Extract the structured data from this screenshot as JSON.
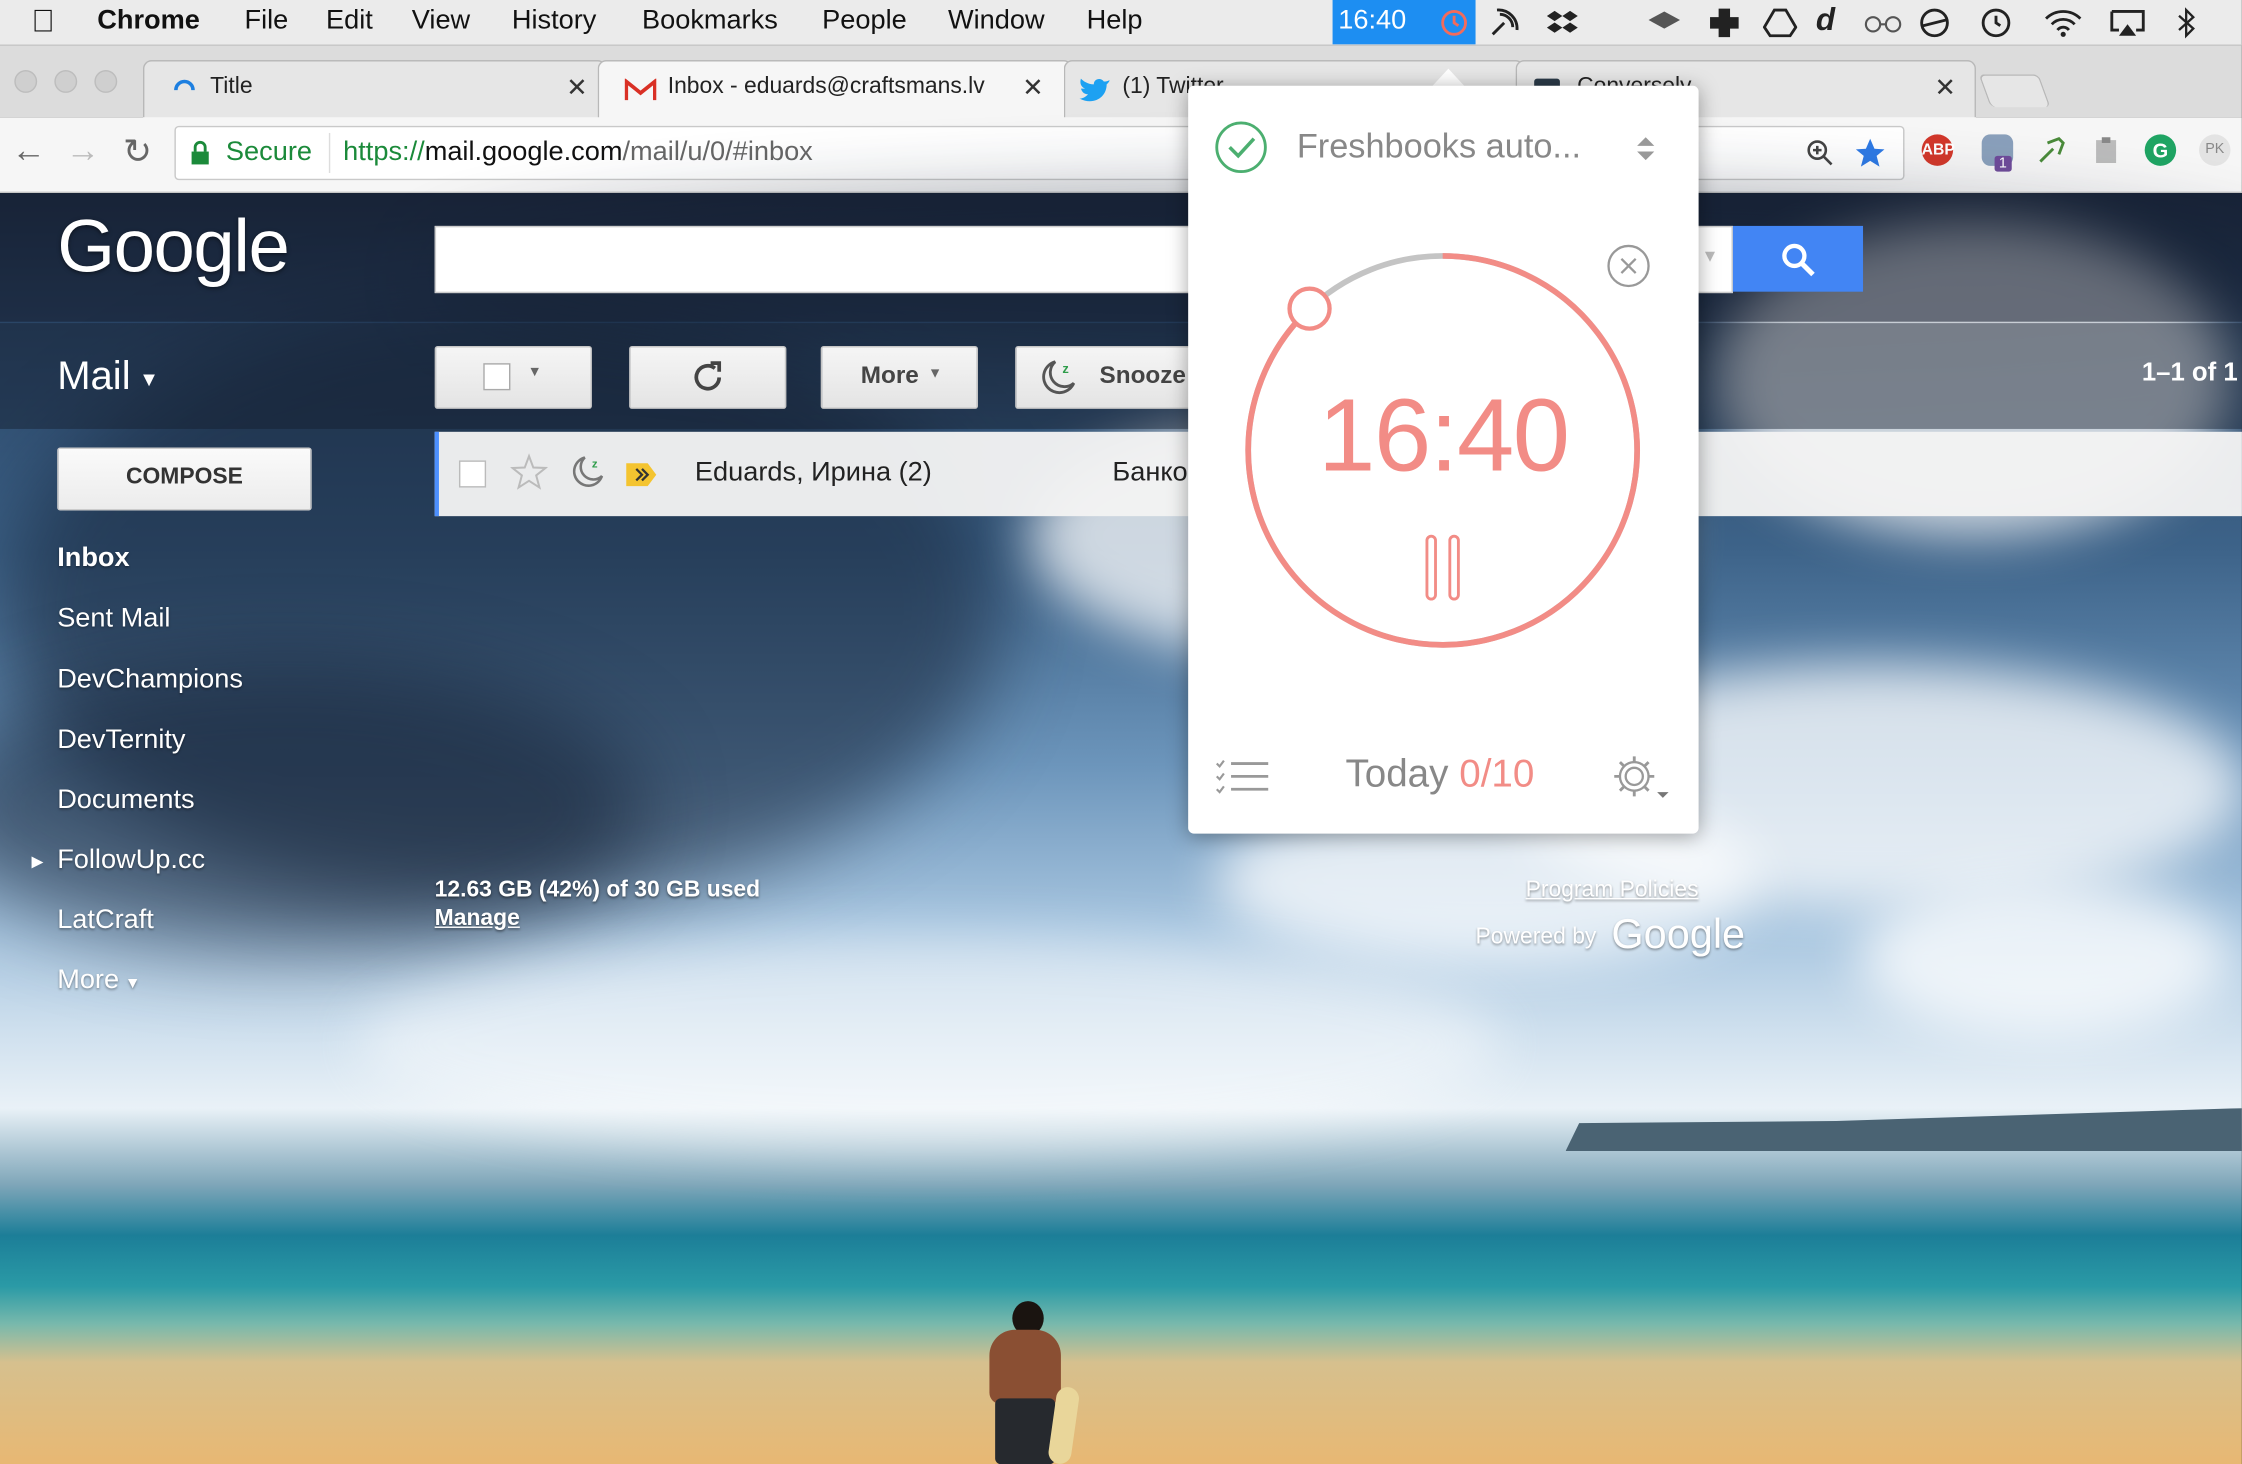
{
  "menubar": {
    "apple": "",
    "app_name": "Chrome",
    "items": [
      "File",
      "Edit",
      "View",
      "History",
      "Bookmarks",
      "People",
      "Window",
      "Help"
    ],
    "clock": "16:40"
  },
  "tabs": [
    {
      "title": "Title"
    },
    {
      "title": "Inbox - eduards@craftsmans.lv"
    },
    {
      "title": "(1) Twitter"
    },
    {
      "title": "Conversely"
    }
  ],
  "toolbar": {
    "secure_label": "Secure",
    "url_scheme": "https://",
    "url_host": "mail.google.com",
    "url_path": "/mail/u/0/#inbox"
  },
  "extensions": {
    "abp": "ABP",
    "badge": "1",
    "pk": "PK"
  },
  "gmail": {
    "logo": "Google",
    "mail_label": "Mail",
    "toolbar": {
      "more_label": "More",
      "snooze_label": "Snooze"
    },
    "pagination": "1–1 of 1",
    "compose_label": "COMPOSE",
    "sidebar": [
      {
        "label": "Inbox",
        "bold": true
      },
      {
        "label": "Sent Mail"
      },
      {
        "label": "DevChampions"
      },
      {
        "label": "DevTernity"
      },
      {
        "label": "Documents"
      },
      {
        "label": "FollowUp.cc"
      },
      {
        "label": "LatCraft"
      },
      {
        "label": "More"
      }
    ],
    "email_rows": [
      {
        "sender": "Eduards, Ирина (2)",
        "subject": "Банко"
      }
    ],
    "storage": "12.63 GB (42%) of 30 GB used",
    "manage_label": "Manage",
    "program_policies": "Program Policies",
    "powered_by": "Powered by",
    "powered_logo": "Google"
  },
  "timer_popup": {
    "task_title": "Freshbooks auto...",
    "time": "16:40",
    "progress": 0.88,
    "today_label": "Today",
    "today_count": "0/10",
    "accent_color": "#f28c86",
    "check_color": "#4caf70"
  }
}
